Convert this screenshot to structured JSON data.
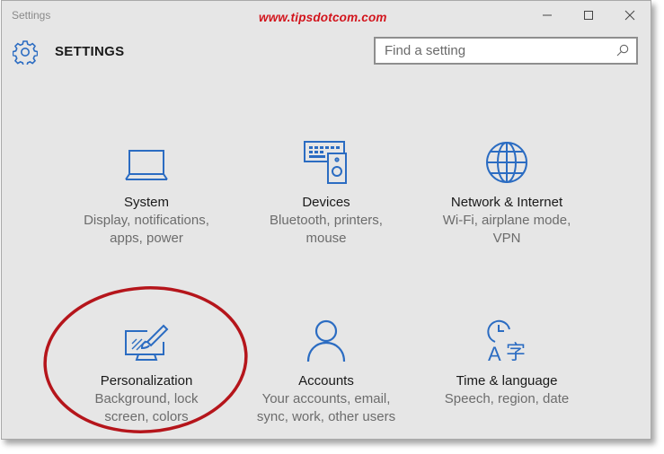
{
  "window": {
    "title": "Settings",
    "watermark": "www.tipsdotcom.com"
  },
  "header": {
    "title": "SETTINGS",
    "search_placeholder": "Find a setting"
  },
  "tiles": [
    {
      "name": "System",
      "desc1": "Display, notifications,",
      "desc2": "apps, power",
      "icon": "laptop-icon"
    },
    {
      "name": "Devices",
      "desc1": "Bluetooth, printers,",
      "desc2": "mouse",
      "icon": "devices-icon"
    },
    {
      "name": "Network & Internet",
      "desc1": "Wi-Fi, airplane mode,",
      "desc2": "VPN",
      "icon": "globe-icon"
    },
    {
      "name": "Personalization",
      "desc1": "Background, lock",
      "desc2": "screen, colors",
      "icon": "paintbrush-monitor-icon"
    },
    {
      "name": "Accounts",
      "desc1": "Your accounts, email,",
      "desc2": "sync, work, other users",
      "icon": "person-icon"
    },
    {
      "name": "Time & language",
      "desc1": "Speech, region, date",
      "desc2": "",
      "icon": "clock-language-icon"
    }
  ],
  "colors": {
    "accent": "#2b6cc2",
    "highlight": "#b5151b",
    "background": "#e6e6e6"
  }
}
